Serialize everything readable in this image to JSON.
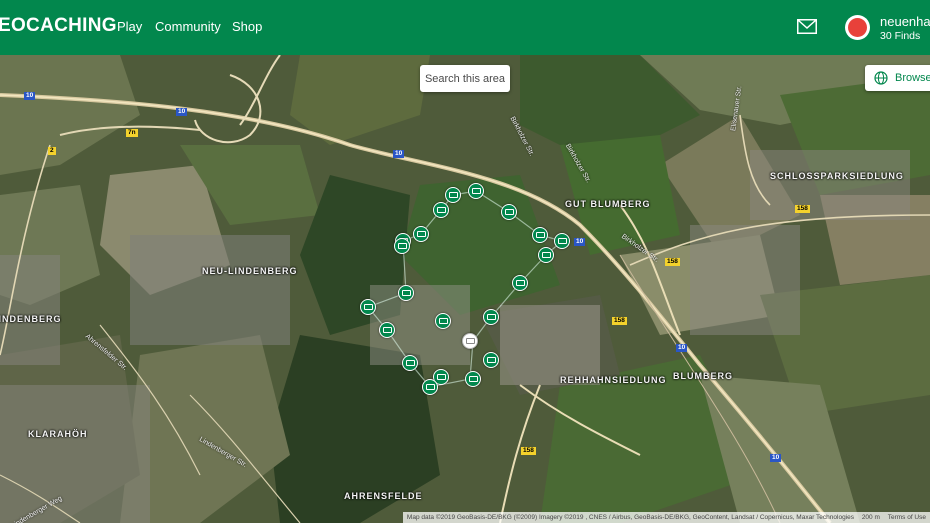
{
  "header": {
    "logo_text": "EOCACHING",
    "nav": {
      "play": "Play",
      "community": "Community",
      "shop": "Shop"
    },
    "icons": {
      "mail": "envelope-icon",
      "avatar": "user-avatar"
    },
    "user": {
      "name": "neuenhag",
      "finds": "30 Finds"
    },
    "brand_color": "#02874d"
  },
  "map": {
    "search_area_label": "Search this area",
    "browse_label": "Browse",
    "places": [
      "SCHLOSSPARKSIEDLUNG",
      "GUT BLUMBERG",
      "NEU-LINDENBERG",
      "LINDENBERG",
      "KLARAHÖH",
      "REHHAHNSIEDLUNG",
      "BLUMBERG",
      "AHRENSFELDE"
    ],
    "road_shields": [
      "10",
      "10",
      "10",
      "10",
      "10",
      "10",
      "2",
      "7n",
      "158",
      "158",
      "158",
      "158"
    ],
    "streets": [
      "Birkholzer Str.",
      "Birkholzer Str.",
      "Elisenauer Str.",
      "Birkholzer Str.",
      "Ahrensfelder Str.",
      "Lindenberger Str.",
      "Lindenberger Weg"
    ],
    "attribution": "Map data ©2019 GeoBasis-DE/BKG (©2009) Imagery ©2019 , CNES / Airbus, GeoBasis-DE/BKG, GeoContent, Landsat / Copernicus, Maxar Technologies",
    "scale": "200 m",
    "terms": "Terms of Use",
    "marker_count": 27
  }
}
